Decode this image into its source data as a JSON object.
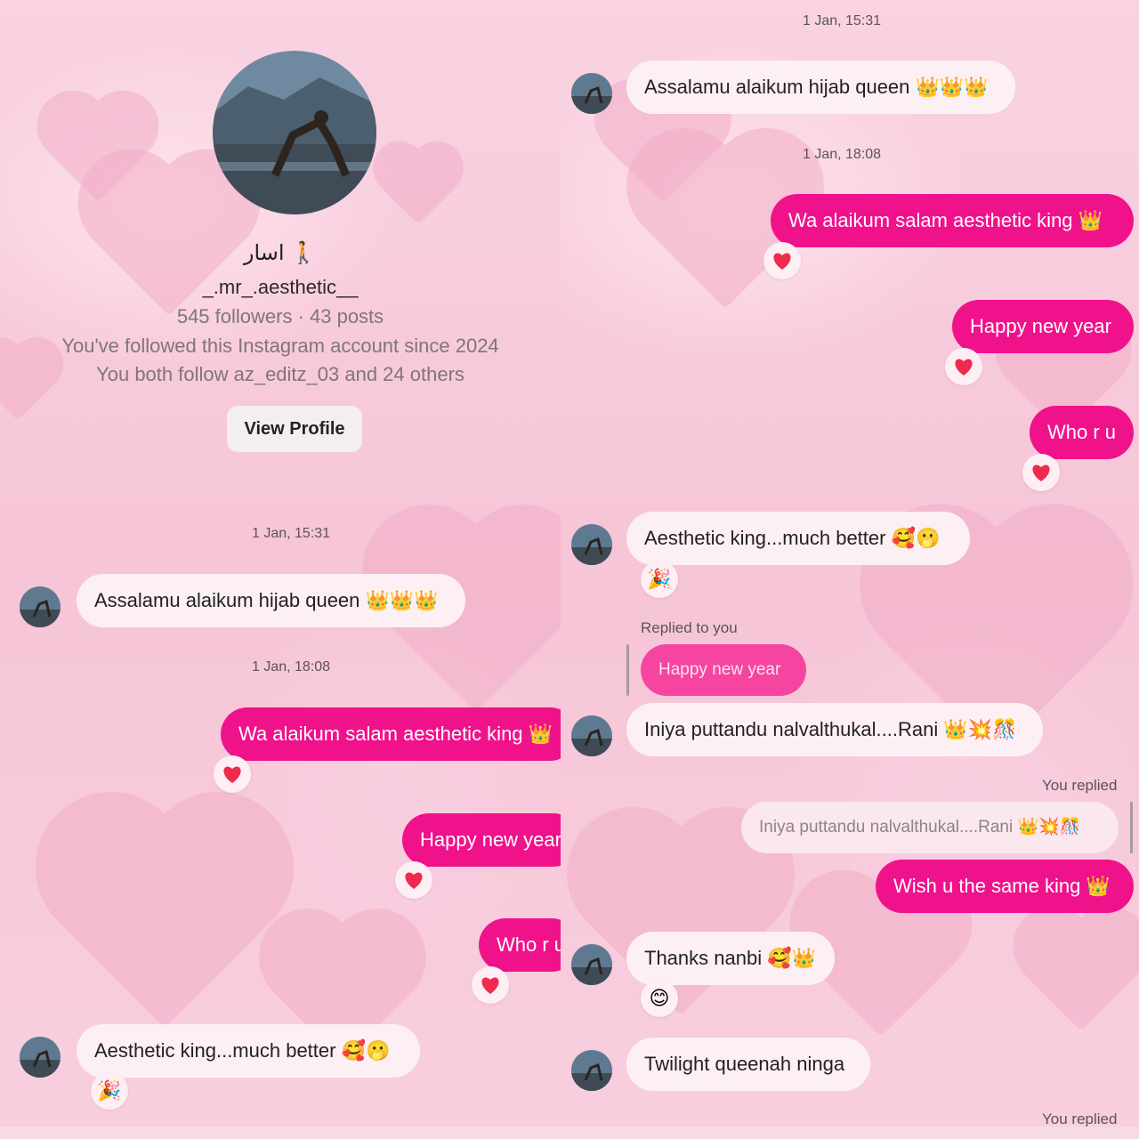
{
  "profile": {
    "display_name": "اسار 🚶",
    "username": "_.mr_.aesthetic__",
    "stats": "545 followers · 43 posts",
    "followed_since": "You've followed this Instagram account since 2024",
    "mutuals": "You both follow az_editz_03 and 24 others",
    "view_profile_label": "View Profile"
  },
  "left": {
    "ts1": "1 Jan, 15:31",
    "m1": "Assalamu alaikum hijab queen 👑👑👑",
    "ts2": "1 Jan, 18:08",
    "m2": "Wa alaikum salam aesthetic king 👑",
    "m3": "Happy new year",
    "m4": "Who r u",
    "m5": "Aesthetic king...much better 🥰🫢",
    "m5_reaction": "🎉"
  },
  "right": {
    "ts1": "1 Jan, 15:31",
    "m1": "Assalamu alaikum hijab queen 👑👑👑",
    "ts2": "1 Jan, 18:08",
    "m2": "Wa alaikum salam aesthetic king 👑",
    "m3": "Happy new year",
    "m4": "Who r u",
    "m5": "Aesthetic king...much better 🥰🫢",
    "m5_reaction": "🎉",
    "replied_to_you": "Replied to you",
    "quoted_mine": "Happy new year",
    "m6": "Iniya puttandu nalvalthukal....Rani 👑💥🎊",
    "you_replied_1": "You replied",
    "quoted_theirs": "Iniya puttandu nalvalthukal....Rani 👑💥🎊",
    "m7": "Wish u the same king 👑",
    "m8": "Thanks nanbi 🥰👑",
    "m8_reaction": "😊",
    "m9": "Twilight queenah ninga",
    "you_replied_2": "You replied"
  },
  "colors": {
    "outgoing": "#f0128b",
    "incoming": "#fdf0f4",
    "heart": "#ee2a4e",
    "background": "#f7c9da"
  },
  "icons": {
    "reaction": "red-heart-icon"
  }
}
